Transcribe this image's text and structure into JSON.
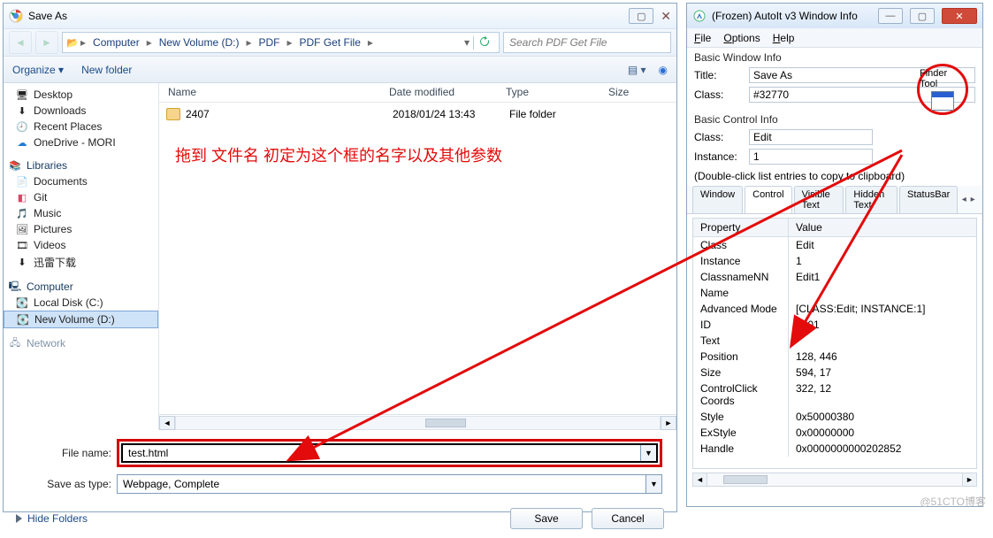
{
  "saveas": {
    "title": "Save As",
    "breadcrumbs": [
      "Computer",
      "New Volume (D:)",
      "PDF",
      "PDF Get File"
    ],
    "search_placeholder": "Search PDF Get File",
    "toolbar": {
      "organize": "Organize",
      "newfolder": "New folder"
    },
    "tree": {
      "desktop": "Desktop",
      "downloads": "Downloads",
      "recent": "Recent Places",
      "onedrive": "OneDrive - MORI",
      "libraries": "Libraries",
      "documents": "Documents",
      "git": "Git",
      "music": "Music",
      "pictures": "Pictures",
      "videos": "Videos",
      "xunlei": "迅雷下载",
      "computer": "Computer",
      "localc": "Local Disk (C:)",
      "newvol": "New Volume (D:)",
      "network": "Network"
    },
    "cols": {
      "name": "Name",
      "date": "Date modified",
      "type": "Type",
      "size": "Size"
    },
    "row": {
      "name": "2407",
      "date": "2018/01/24 13:43",
      "type": "File folder"
    },
    "annotation": "拖到 文件名 初定为这个框的名字以及其他参数",
    "filename_label": "File name:",
    "filename_value": "test.html",
    "saveastype_label": "Save as type:",
    "saveastype_value": "Webpage, Complete",
    "hide": "Hide Folders",
    "save": "Save",
    "cancel": "Cancel"
  },
  "autoit": {
    "title": "(Frozen) AutoIt v3 Window Info",
    "menu": {
      "file": "File",
      "options": "Options",
      "help": "Help"
    },
    "basic_window": "Basic Window Info",
    "bw_title_k": "Title:",
    "bw_title_v": "Save As",
    "bw_class_k": "Class:",
    "bw_class_v": "#32770",
    "basic_control": "Basic Control Info",
    "bc_class_k": "Class:",
    "bc_class_v": "Edit",
    "bc_inst_k": "Instance:",
    "bc_inst_v": "1",
    "finder": "Finder Tool",
    "dbl": "(Double-click list entries to copy to clipboard)",
    "tabs": [
      "Window",
      "Control",
      "Visible Text",
      "Hidden Text",
      "StatusBar"
    ],
    "grid_head_prop": "Property",
    "grid_head_val": "Value",
    "rows": [
      {
        "p": "Class",
        "v": "Edit"
      },
      {
        "p": "Instance",
        "v": "1"
      },
      {
        "p": "ClassnameNN",
        "v": "Edit1"
      },
      {
        "p": "Name",
        "v": ""
      },
      {
        "p": "Advanced Mode",
        "v": "[CLASS:Edit; INSTANCE:1]"
      },
      {
        "p": "ID",
        "v": "1001"
      },
      {
        "p": "Text",
        "v": ""
      },
      {
        "p": "Position",
        "v": "128, 446"
      },
      {
        "p": "Size",
        "v": "594, 17"
      },
      {
        "p": "ControlClick Coords",
        "v": "322, 12"
      },
      {
        "p": "Style",
        "v": "0x50000380"
      },
      {
        "p": "ExStyle",
        "v": "0x00000000"
      },
      {
        "p": "Handle",
        "v": "0x0000000000202852"
      }
    ],
    "status": [
      "dden Text",
      "StatusBar"
    ]
  },
  "watermark": "@51CTO博客"
}
